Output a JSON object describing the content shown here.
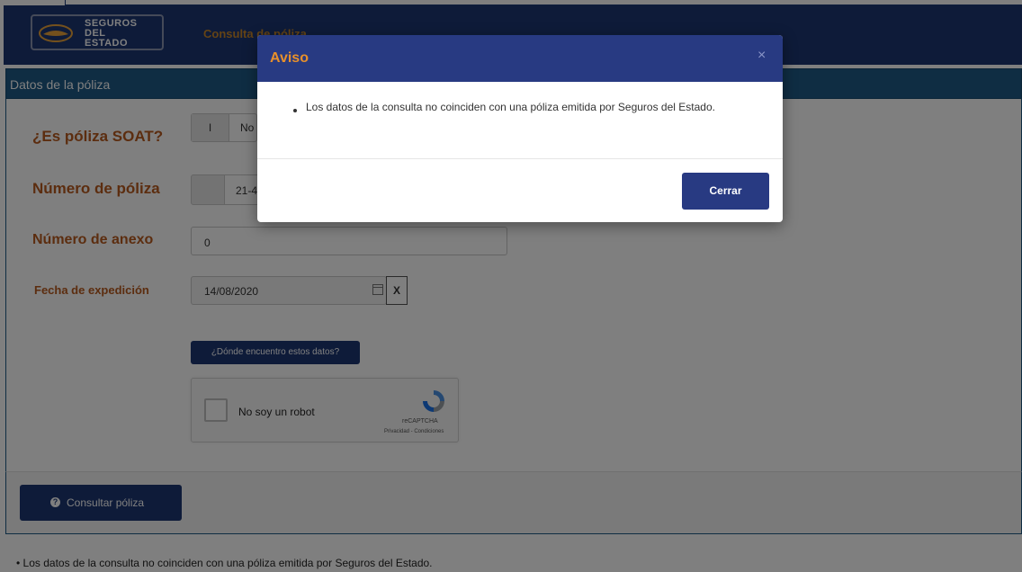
{
  "header": {
    "logo_line1": "SEGUROS",
    "logo_line2": "DEL",
    "logo_line3": "ESTADO",
    "nav_link": "Consulta de póliza"
  },
  "section": {
    "title": "Datos de la póliza"
  },
  "form": {
    "soat_label": "¿Es póliza SOAT?",
    "soat_toggle_knob": "I",
    "soat_value": "No",
    "poliza_label": "Número de póliza",
    "poliza_value": "21-4",
    "anexo_label": "Número de anexo",
    "anexo_value": "0",
    "fecha_label": "Fecha de expedición",
    "fecha_value": "14/08/2020",
    "clear_label": "X",
    "help_button": "¿Dónde encuentro estos datos?"
  },
  "captcha": {
    "label": "No soy un robot",
    "brand": "reCAPTCHA",
    "terms": "Privacidad - Condiciones"
  },
  "actions": {
    "consult_button": "Consultar póliza",
    "consult_icon": "?"
  },
  "footer": {
    "message": "Los datos de la consulta no coinciden con una póliza emitida por Seguros del Estado."
  },
  "modal": {
    "title": "Aviso",
    "close": "×",
    "message": "Los datos de la consulta no coinciden con una póliza emitida por Seguros del Estado.",
    "button": "Cerrar"
  },
  "colors": {
    "brand_navy": "#1d3672",
    "label_orange": "#b85a1e",
    "modal_title": "#e8902a"
  }
}
